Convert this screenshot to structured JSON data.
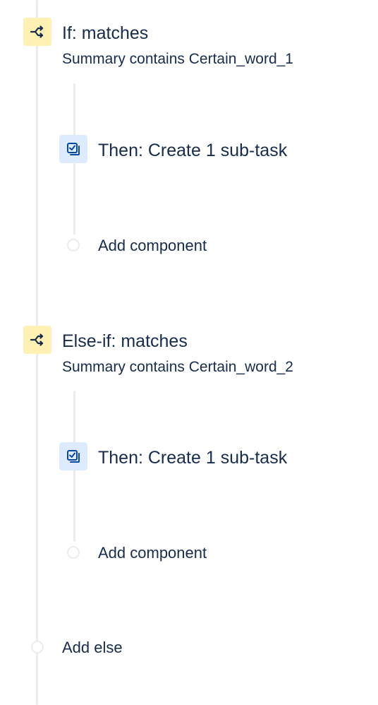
{
  "if_block": {
    "icon": "branch-icon",
    "title": "If: matches",
    "condition": "Summary contains Certain_word_1",
    "action": {
      "icon": "subtask-icon",
      "label": "Then: Create 1 sub-task"
    },
    "add_component_label": "Add component"
  },
  "else_if_block": {
    "icon": "branch-icon",
    "title": "Else-if: matches",
    "condition": "Summary contains Certain_word_2",
    "action": {
      "icon": "subtask-icon",
      "label": "Then: Create 1 sub-task"
    },
    "add_component_label": "Add component"
  },
  "add_else_label": "Add else",
  "colors": {
    "condition_icon_bg": "#fff0b3",
    "action_icon_bg": "#deebff",
    "icon_fg": "#0747a6",
    "text": "#172b4d",
    "rail": "#ebecf0"
  }
}
